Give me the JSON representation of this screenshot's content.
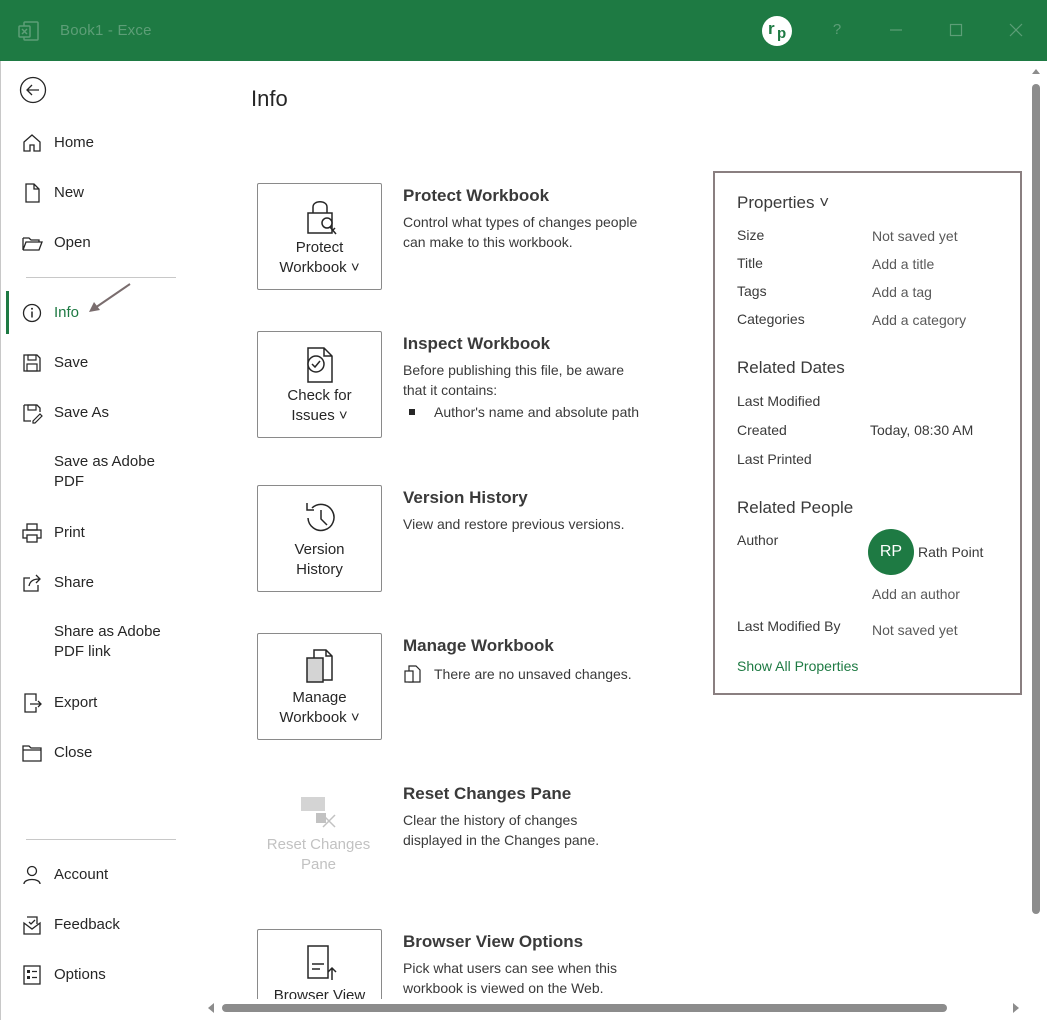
{
  "window": {
    "title": "Book1  -  Exce",
    "help_label": "?",
    "avatar_initials_r": "r",
    "avatar_initials_p": "p"
  },
  "colors": {
    "accent": "#1e7a43",
    "panel_border": "#8a7f80",
    "text": "#262626"
  },
  "sidebar": {
    "items": [
      {
        "label": "Home",
        "icon": "home-icon"
      },
      {
        "label": "New",
        "icon": "new-file-icon"
      },
      {
        "label": "Open",
        "icon": "folder-open-icon"
      },
      {
        "label": "Info",
        "icon": "info-icon",
        "active": true
      },
      {
        "label": "Save",
        "icon": "save-icon"
      },
      {
        "label": "Save As",
        "icon": "save-as-icon"
      },
      {
        "label": "Save as Adobe PDF",
        "icon": ""
      },
      {
        "label": "Print",
        "icon": "print-icon"
      },
      {
        "label": "Share",
        "icon": "share-icon"
      },
      {
        "label": "Share as Adobe PDF link",
        "icon": ""
      },
      {
        "label": "Export",
        "icon": "export-icon"
      },
      {
        "label": "Close",
        "icon": "close-folder-icon"
      },
      {
        "label": "Account",
        "icon": "account-icon"
      },
      {
        "label": "Feedback",
        "icon": "feedback-icon"
      },
      {
        "label": "Options",
        "icon": "options-icon"
      }
    ]
  },
  "main": {
    "title": "Info",
    "sections": [
      {
        "button_label": "Protect Workbook ˅",
        "button_line1": "Protect",
        "button_line2": "Workbook ˅",
        "title": "Protect Workbook",
        "description": "Control what types of changes people can make to this workbook."
      },
      {
        "button_line1": "Check for",
        "button_line2": "Issues ˅",
        "title": "Inspect Workbook",
        "description": "Before publishing this file, be aware that it contains:",
        "bullet": "Author's name and absolute path"
      },
      {
        "button_line1": "Version",
        "button_line2": "History",
        "title": "Version History",
        "description": "View and restore previous versions."
      },
      {
        "button_line1": "Manage",
        "button_line2": "Workbook ˅",
        "title": "Manage Workbook",
        "status": "There are no unsaved changes."
      },
      {
        "button_line1": "Reset Changes",
        "button_line2": "Pane",
        "title": "Reset Changes Pane",
        "description": "Clear the history of changes displayed in the Changes pane."
      },
      {
        "button_line1": "Browser View",
        "button_line2": "",
        "title": "Browser View Options",
        "description": "Pick what users can see when this workbook is viewed on the Web."
      }
    ]
  },
  "properties": {
    "heading": "Properties ˅",
    "rows": [
      {
        "label": "Size",
        "value": "Not saved yet"
      },
      {
        "label": "Title",
        "value": "Add a title"
      },
      {
        "label": "Tags",
        "value": "Add a tag"
      },
      {
        "label": "Categories",
        "value": "Add a category"
      }
    ],
    "related_dates_heading": "Related Dates",
    "dates": [
      {
        "label": "Last Modified",
        "value": ""
      },
      {
        "label": "Created",
        "value": "Today, 08:30 AM"
      },
      {
        "label": "Last Printed",
        "value": ""
      }
    ],
    "related_people_heading": "Related People",
    "author_label": "Author",
    "author_initials": "RP",
    "author_name": "Rath Point",
    "add_author": "Add an author",
    "last_modified_by_label": "Last Modified By",
    "last_modified_by_value": "Not saved yet",
    "show_all": "Show All Properties"
  }
}
